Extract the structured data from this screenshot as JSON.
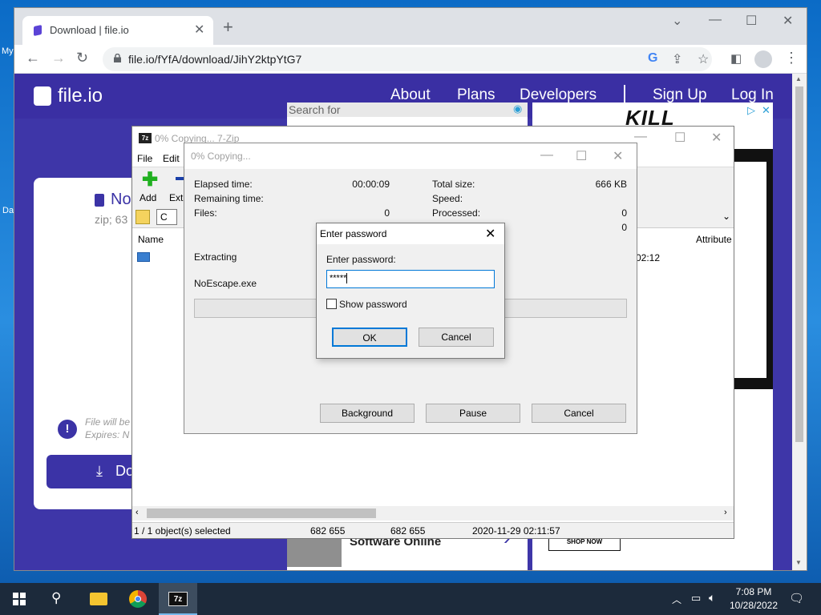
{
  "desktop": {
    "label_1": "My",
    "label_2": "Da"
  },
  "browser": {
    "tab_title": "Download | file.io",
    "url": "file.io/fYfA/download/JihY2ktpYtG7",
    "new_tab_symbol": "+",
    "close_symbol": "✕"
  },
  "page": {
    "logo_text": "file.io",
    "nav": {
      "about": "About",
      "plans": "Plans",
      "developers": "Developers",
      "sign_up": "Sign Up",
      "log_in": "Log In"
    },
    "card": {
      "file_name": "No",
      "file_meta": "zip; 63",
      "note_1": "File will be",
      "note_2": "Expires: N",
      "download_label": "Do"
    },
    "ad_left": {
      "search_placeholder": "Search for",
      "bottom_text": "Software Online"
    },
    "ad_right": {
      "brand": "KILL",
      "shop_label": "SHOP NOW"
    }
  },
  "file_manager": {
    "title": "0% Copying... 7-Zip",
    "menu": [
      "File",
      "Edit"
    ],
    "toolbar": {
      "add": "Add",
      "extract": "Extr"
    },
    "address_text": "C",
    "columns": {
      "name": "Name",
      "attributes": "Attribute"
    },
    "row": {
      "date_fragment": "02:12"
    },
    "status": {
      "selected": "1 / 1 object(s) selected",
      "size": "682 655",
      "packed": "682 655",
      "modified": "2020-11-29 02:11:57"
    }
  },
  "progress": {
    "title": "0% Copying...",
    "elapsed_label": "Elapsed time:",
    "elapsed_value": "00:00:09",
    "remaining_label": "Remaining time:",
    "files_label": "Files:",
    "files_value": "0",
    "total_size_label": "Total size:",
    "total_size_value": "666 KB",
    "speed_label": "Speed:",
    "processed_label": "Processed:",
    "processed_value": "0",
    "extra_value": "0",
    "action": "Extracting",
    "current_file": "NoEscape.exe",
    "buttons": {
      "background": "Background",
      "pause": "Pause",
      "cancel": "Cancel"
    }
  },
  "password_dialog": {
    "title": "Enter password",
    "label": "Enter password:",
    "value": "*****",
    "show_password": "Show password",
    "ok": "OK",
    "cancel": "Cancel"
  },
  "taskbar": {
    "time": "7:08 PM",
    "date": "10/28/2022"
  },
  "colors": {
    "brand_purple": "#3b33a6",
    "chrome_tabstrip": "#dee1e6",
    "dialog_focus": "#0078d7",
    "taskbar": "#1c2a3b"
  }
}
